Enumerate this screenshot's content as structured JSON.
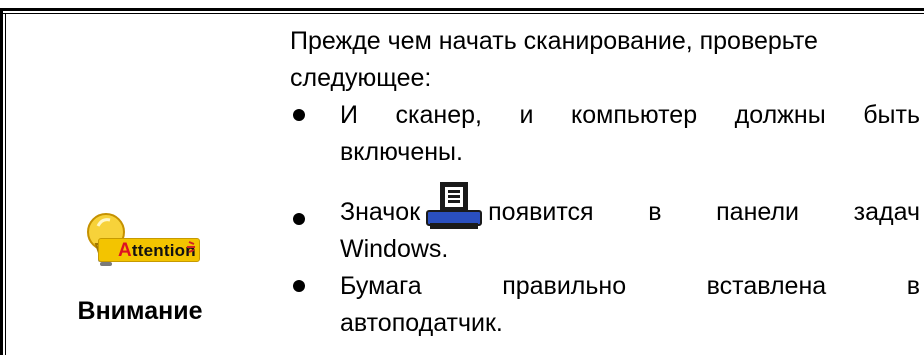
{
  "side": {
    "badge_cap": "A",
    "badge_rest": "ttention",
    "title": "Внимание"
  },
  "content": {
    "intro_line1": "Прежде чем начать сканирование, проверьте",
    "intro_line2": "следующее:",
    "items": [
      {
        "line1": "И сканер, и компьютер должны быть",
        "line2": "включены."
      },
      {
        "before_icon": "Значок",
        "after_icon": "появится в панели задач",
        "line2": "Windows."
      },
      {
        "line1": "Бумага правильно вставлена в",
        "line2": "автоподатчик."
      }
    ],
    "icon_name": "scanner-tray-icon"
  },
  "colors": {
    "badge_yellow": "#f3c400",
    "badge_bulb": "#f7d23a",
    "badge_accent": "#d12222",
    "icon_dark": "#1a1a1a",
    "icon_blue": "#2a4fbf"
  }
}
